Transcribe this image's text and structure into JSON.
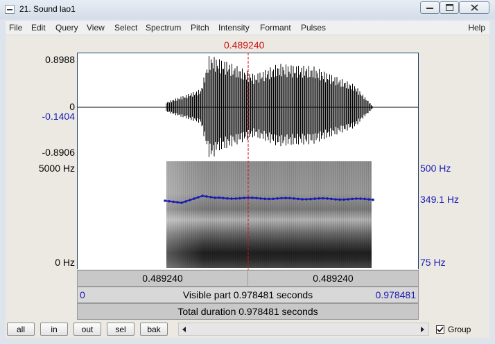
{
  "window": {
    "title": "21. Sound lao1"
  },
  "menu": [
    "File",
    "Edit",
    "Query",
    "View",
    "Select",
    "Spectrum",
    "Pitch",
    "Intensity",
    "Formant",
    "Pulses"
  ],
  "menu_help": "Help",
  "cursor": {
    "time": "0.489240"
  },
  "waveform": {
    "y_top": "0.8988",
    "y_zero": "0",
    "y_cursor": "-0.1404",
    "y_bottom": "-0.8906"
  },
  "spectrogram": {
    "freq_top": "5000 Hz",
    "freq_bottom": "0 Hz",
    "pitch_top": "500 Hz",
    "pitch_value": "349.1 Hz",
    "pitch_bottom": "75 Hz"
  },
  "bars": {
    "left_segment": "0.489240",
    "right_segment": "0.489240",
    "visible_start": "0",
    "visible_label": "Visible part 0.978481 seconds",
    "visible_end": "0.978481",
    "total_label": "Total duration 0.978481 seconds"
  },
  "toolbar": {
    "buttons": [
      "all",
      "in",
      "out",
      "sel",
      "bak"
    ],
    "group_label": "Group",
    "group_checked": true
  },
  "colors": {
    "cursor": "#d01010",
    "pitch": "#1a1ab4",
    "border": "#1c3f66"
  }
}
